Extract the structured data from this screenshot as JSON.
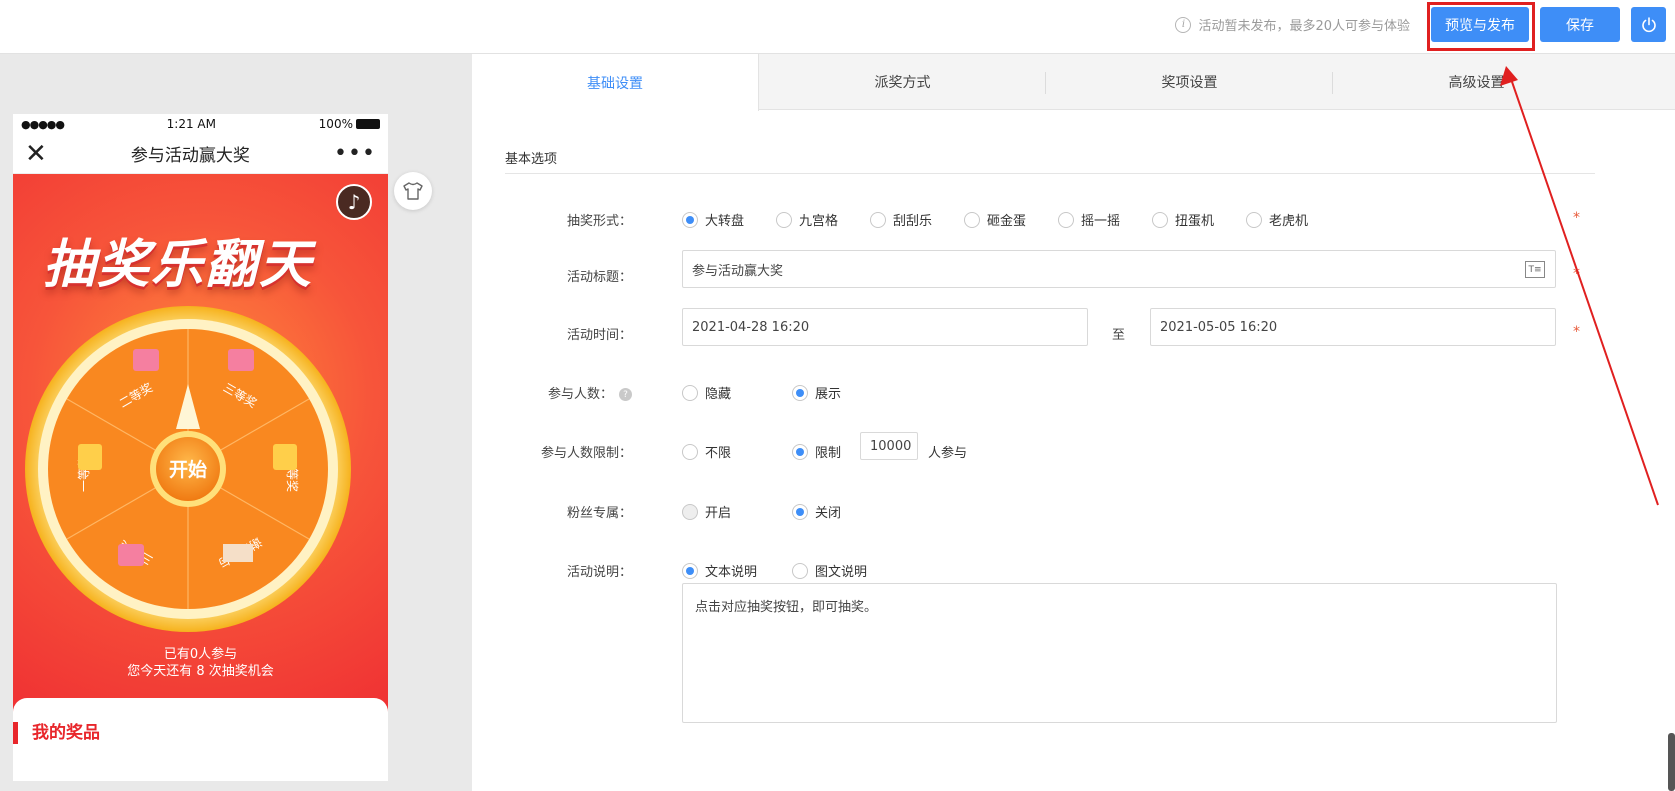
{
  "topbar": {
    "notice": "活动暂未发布，最多20人可参与体验",
    "publish_label": "预览与发布",
    "save_label": "保存"
  },
  "phone": {
    "status_time": "1:21 AM",
    "battery_pct": "100%",
    "page_title": "参与活动赢大奖",
    "banner_title": "抽奖乐翻天",
    "start_label": "开始",
    "wheel_prizes": [
      "三等奖",
      "二等奖",
      "谢谢参与",
      "三等奖",
      "一等奖",
      "二等奖"
    ],
    "join_line1": "已有0人参与",
    "join_line2": "您今天还有 8 次抽奖机会",
    "my_prizes": "我的奖品"
  },
  "tabs": [
    "基础设置",
    "派奖方式",
    "奖项设置",
    "高级设置"
  ],
  "form": {
    "section_title": "基本选项",
    "lottery_type_label": "抽奖形式：",
    "lottery_types": [
      "大转盘",
      "九宫格",
      "刮刮乐",
      "砸金蛋",
      "摇一摇",
      "扭蛋机",
      "老虎机"
    ],
    "title_label": "活动标题：",
    "title_value": "参与活动赢大奖",
    "time_label": "活动时间：",
    "start_time": "2021-04-28 16:20",
    "time_to": "至",
    "end_time": "2021-05-05 16:20",
    "participants_label": "参与人数：",
    "participants_options": [
      "隐藏",
      "展示"
    ],
    "limit_label": "参与人数限制：",
    "limit_options": [
      "不限",
      "限制"
    ],
    "limit_value": "10000",
    "limit_suffix": "人参与",
    "fans_label": "粉丝专属：",
    "fans_options": [
      "开启",
      "关闭"
    ],
    "desc_label": "活动说明：",
    "desc_options": [
      "文本说明",
      "图文说明"
    ],
    "desc_value": "点击对应抽奖按钮，即可抽奖。",
    "required_mark": "*"
  },
  "colors": {
    "accent": "#3e8ef7",
    "highlight": "#e02020",
    "required": "#e85a3a"
  }
}
